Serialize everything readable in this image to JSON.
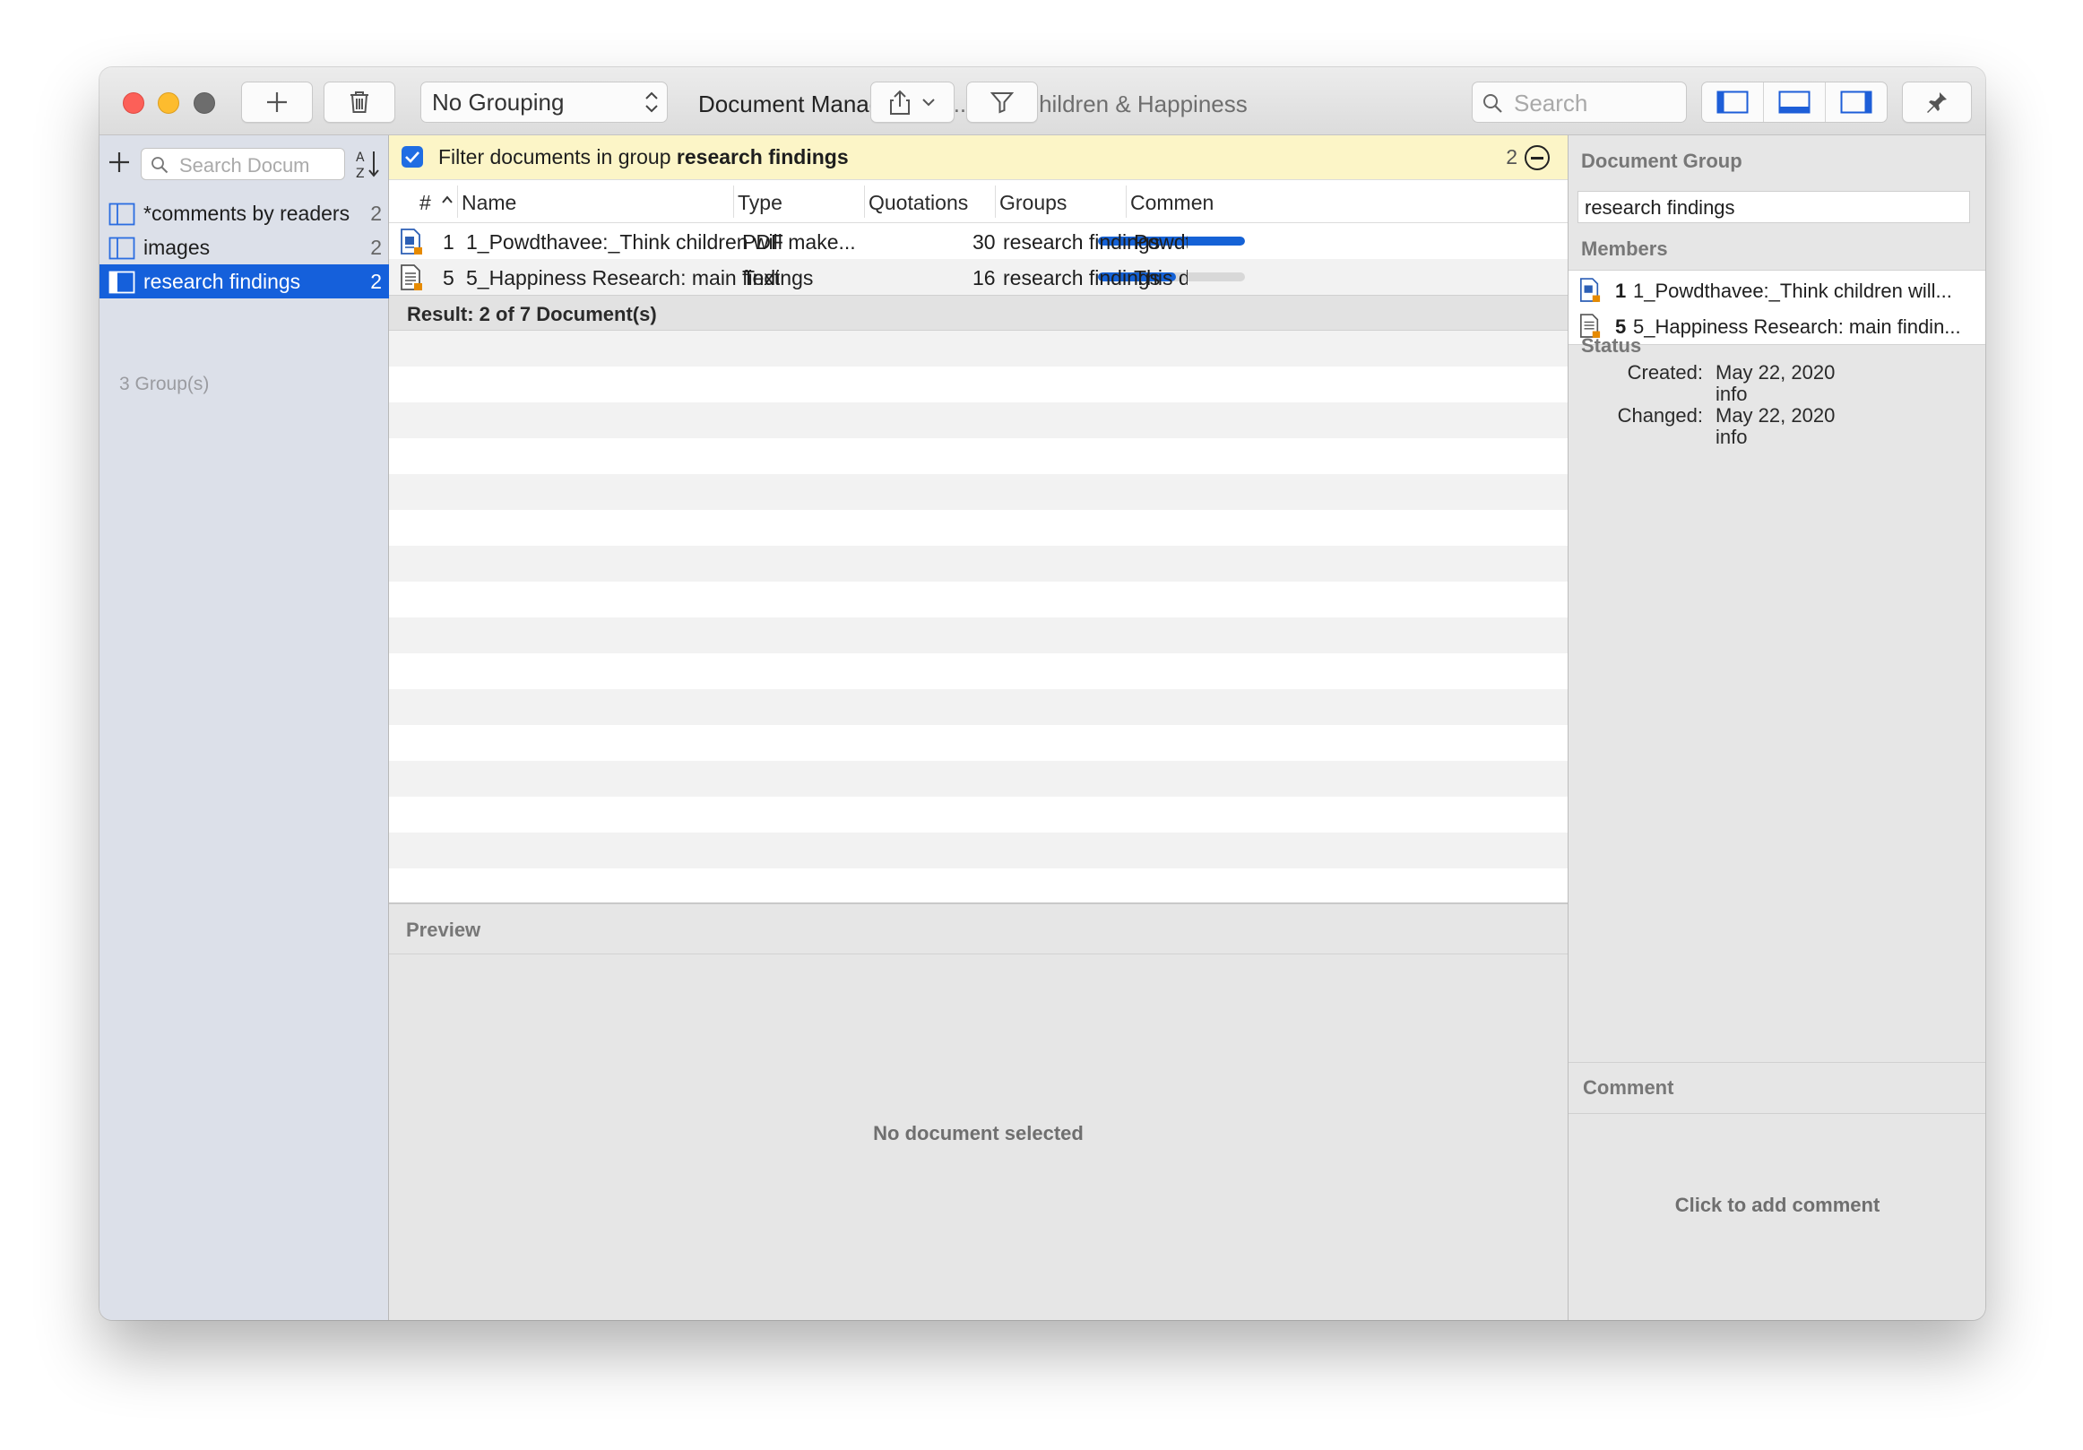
{
  "window": {
    "title": "Document Manager",
    "subtitle": "— A...ject: Children & Happiness"
  },
  "toolbar": {
    "add_icon": "plus-icon",
    "delete_icon": "trash-icon",
    "grouping_value": "No Grouping",
    "share_icon": "share-icon",
    "filter_icon": "funnel-icon",
    "search_placeholder": "Search",
    "view_icons": [
      "left-panel-icon",
      "bottom-panel-icon",
      "right-panel-icon"
    ],
    "pin_icon": "pin-icon"
  },
  "sidebar": {
    "search_placeholder": "Search Docum",
    "groups": [
      {
        "name": "*comments by readers",
        "count": "2"
      },
      {
        "name": "images",
        "count": "2"
      },
      {
        "name": "research findings",
        "count": "2"
      }
    ],
    "footer": "3 Group(s)",
    "selected_color": "#1560db"
  },
  "filter": {
    "prefix": "Filter documents in group ",
    "group": "research findings",
    "count": "2",
    "checked": true
  },
  "table": {
    "columns": [
      "#",
      "Name",
      "Type",
      "Quotations",
      "Groups",
      "Commen"
    ],
    "rows": [
      {
        "num": "1",
        "name": "1_Powdthavee:_Think children will make...",
        "type": "PDF",
        "quotations": "30",
        "quotation_fraction": 1.0,
        "groups": "research findings",
        "comment": "Powdtha"
      },
      {
        "num": "5",
        "name": "5_Happiness Research: main findings",
        "type": "Text",
        "quotations": "16",
        "quotation_fraction": 0.53,
        "groups": "research findings",
        "comment": "This doc"
      }
    ],
    "result": "Result: 2 of 7 Document(s)"
  },
  "preview": {
    "header": "Preview",
    "empty": "No document selected"
  },
  "inspector": {
    "group_header": "Document Group",
    "group_name": "research findings",
    "members_header": "Members",
    "members": [
      {
        "num": "1",
        "name": "1_Powdthavee:_Think children will..."
      },
      {
        "num": "5",
        "name": "5_Happiness Research: main findin..."
      }
    ],
    "status_header": "Status",
    "created_label": "Created:",
    "created_date": "May 22, 2020",
    "created_user": "info",
    "changed_label": "Changed:",
    "changed_date": "May 22, 2020",
    "changed_user": "info",
    "comment_header": "Comment",
    "comment_placeholder": "Click to add comment"
  }
}
